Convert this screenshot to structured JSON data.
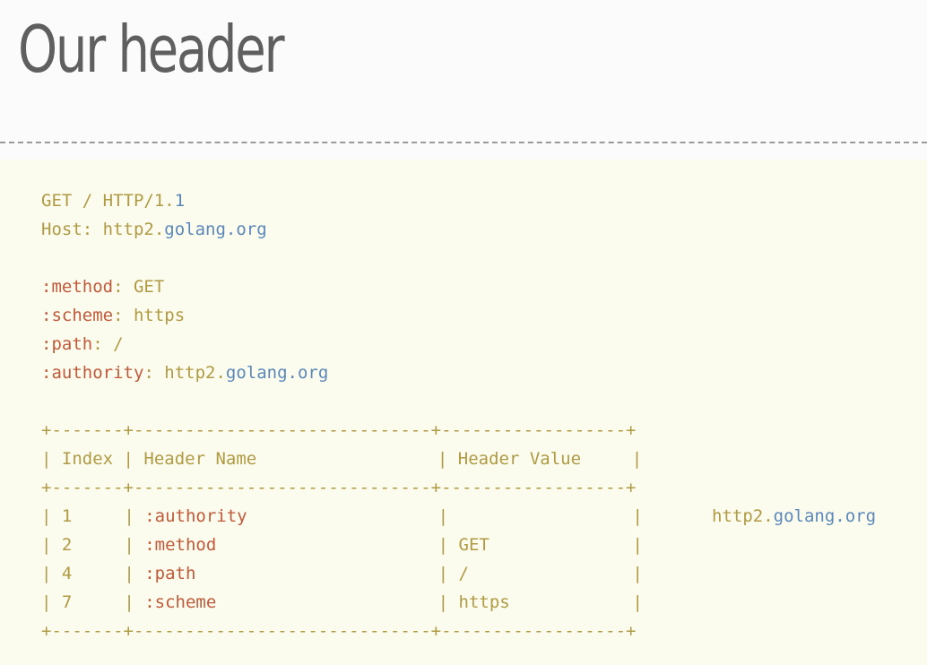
{
  "title": "Our header",
  "request": {
    "line1": {
      "method": "GET / HTTP/1.",
      "version": "1"
    },
    "line2": {
      "key": "Host:",
      "value_host": "http2.",
      "value_domain": "golang.org"
    }
  },
  "pseudo_headers": [
    {
      "key": ":method",
      "sep": ": ",
      "value": "GET",
      "value_style": "olive"
    },
    {
      "key": ":scheme",
      "sep": ": ",
      "value": "https",
      "value_style": "olive"
    },
    {
      "key": ":path",
      "sep": ": ",
      "value": "/",
      "value_style": "olive"
    },
    {
      "key": ":authority",
      "sep": ": ",
      "value_host": "http2.",
      "value_domain": "golang.org"
    }
  ],
  "table": {
    "border_top": "+-------+-----------------------------+------------------+",
    "border_mid": "+-------+-----------------------------+------------------+",
    "border_bot": "+-------+-----------------------------+------------------+",
    "headers": {
      "index": "Index",
      "name": "Header Name",
      "value": "Header Value"
    },
    "rows": [
      {
        "index": "1",
        "name": ":authority",
        "value": ""
      },
      {
        "index": "2",
        "name": ":method",
        "value": "GET"
      },
      {
        "index": "4",
        "name": ":path",
        "value": "/"
      },
      {
        "index": "7",
        "name": ":scheme",
        "value": "https"
      }
    ],
    "overflow_value": {
      "host": "http2.",
      "domain": "golang.org"
    }
  },
  "colors": {
    "key": "#c05a3a",
    "value": "#b09a44",
    "link": "#5b88b8"
  }
}
